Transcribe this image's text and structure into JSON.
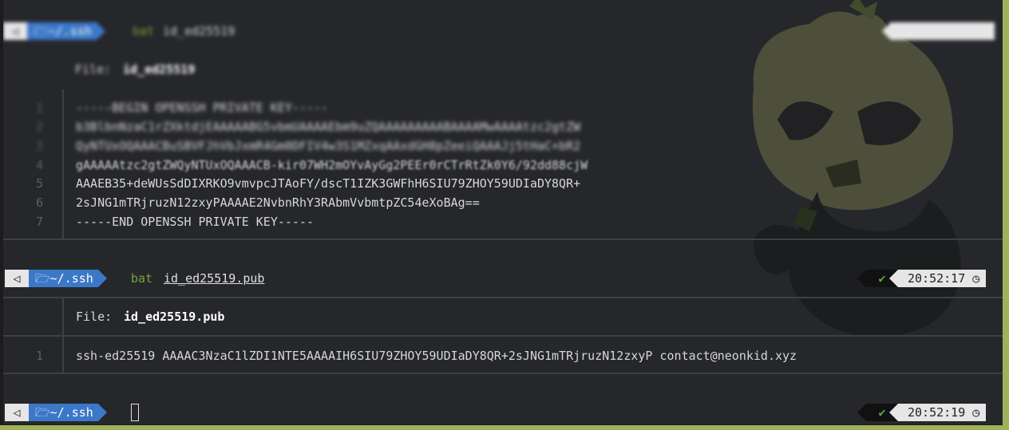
{
  "colors": {
    "accent_blue": "#3c78c8",
    "cmd_green": "#7aa23c",
    "check_green": "#5fa83a",
    "border_olive": "#9fb25a"
  },
  "icons": {
    "os": "distro-logo-icon",
    "folder": "folder-open-icon",
    "clock": "clock-icon",
    "check": "checkmark-icon"
  },
  "top": {
    "prompt_dir": "~/.ssh",
    "command": "bat",
    "argument": "id_ed25519",
    "file_label": "File:",
    "file_name": "id_ed25519",
    "lines": [
      {
        "num": "1",
        "text": "-----BEGIN OPENSSH PRIVATE KEY-----"
      },
      {
        "num": "2",
        "text": "b3BlbnNzaC1rZXktdjEAAAAABG5vbmUAAAAEbm9uZQAAAAAAAAABAAAAMwAAAAtzc2gtZW"
      },
      {
        "num": "3",
        "text": "QyNTUxOQAAACBuSBVFJhVbJxmR4Gm0DFIV4w3S1MZxqAAxdGH8pZeeiQAAAJj5tHaC+bR2"
      },
      {
        "num": "4",
        "text": "gAAAAAtzc2gtZWQyNTUxOQAAACB-kir07WH2mOYvAyGg2PEEr0rCTrRtZk0Y6/92dd88cjW"
      },
      {
        "num": "5",
        "text": "AAAEB35+deWUsSdDIXRKO9vmvpcJTAoFY/dscT1IZK3GWFhH6SIU79ZHOY59UDIaDY8QR+"
      },
      {
        "num": "6",
        "text": "2sJNG1mTRjruzN12zxyPAAAAE2NvbnRhY3RAbmVvbmtpZC54eXoBAg=="
      },
      {
        "num": "7",
        "text": "-----END OPENSSH PRIVATE KEY-----"
      }
    ]
  },
  "prompt1": {
    "dir": "~/.ssh",
    "command": "bat",
    "argument": "id_ed25519.pub",
    "time": "20:52:17"
  },
  "output": {
    "file_label": "File:",
    "file_name": "id_ed25519.pub",
    "line_num": "1",
    "line_text": "ssh-ed25519 AAAAC3NzaC1lZDI1NTE5AAAAIH6SIU79ZHOY59UDIaDY8QR+2sJNG1mTRjruzN12zxyP contact@neonkid.xyz"
  },
  "prompt2": {
    "dir": "~/.ssh",
    "time": "20:52:19"
  }
}
